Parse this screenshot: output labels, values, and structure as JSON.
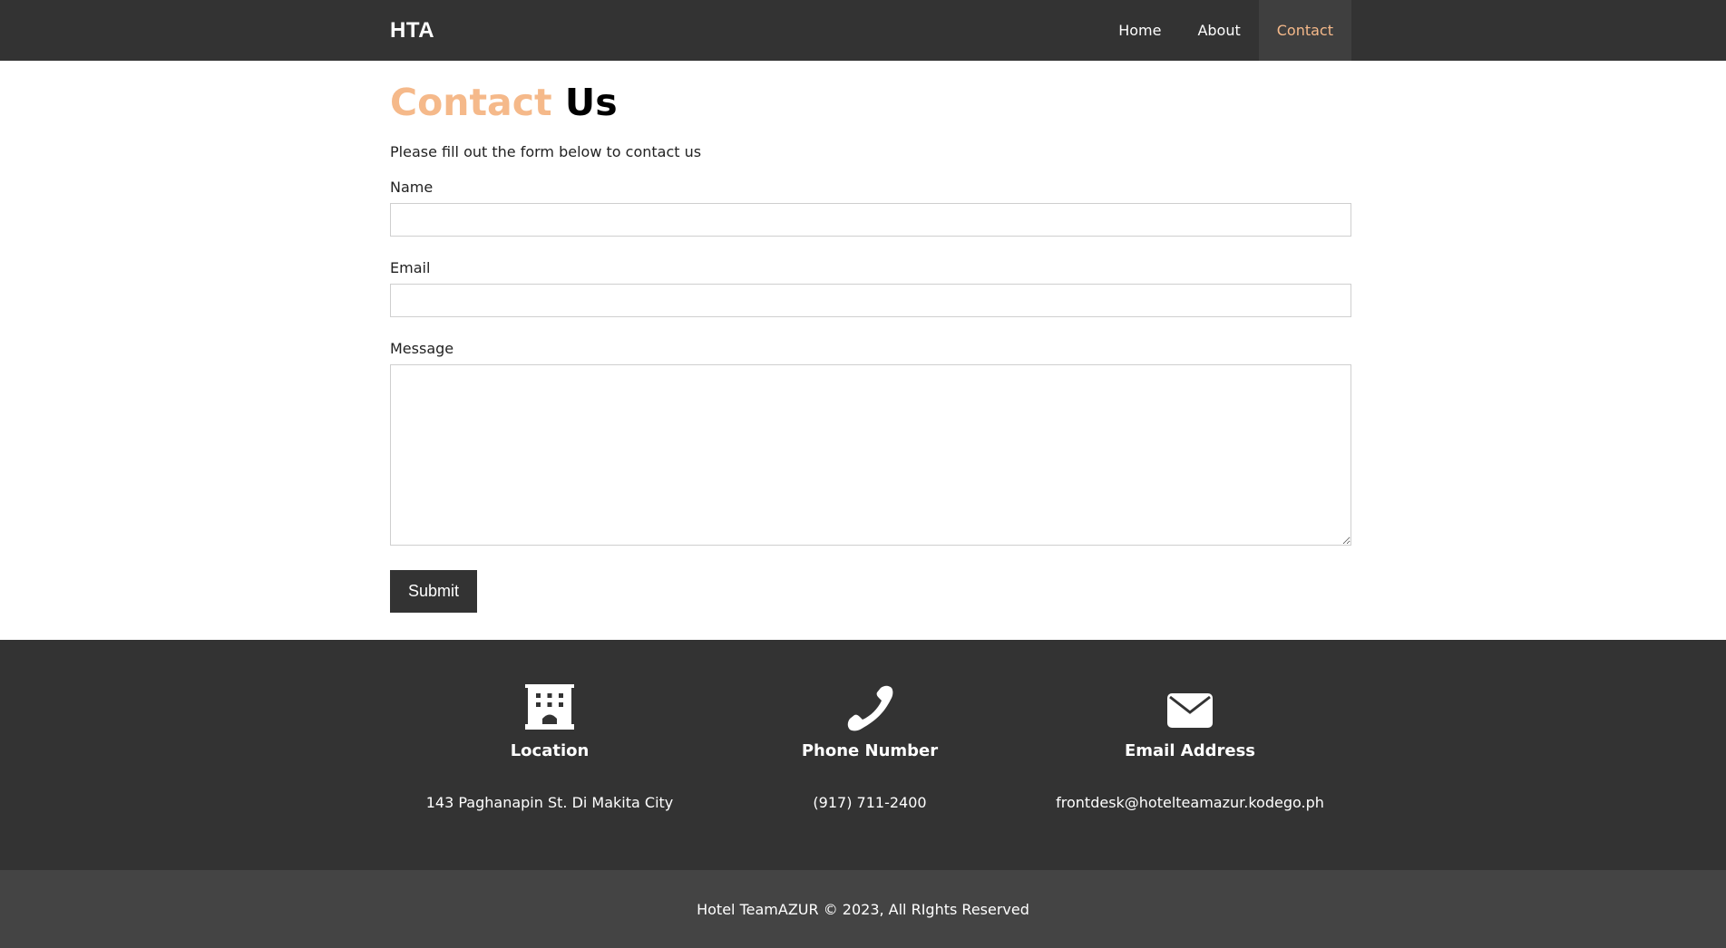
{
  "nav": {
    "brand": "HTA",
    "links": [
      {
        "label": "Home",
        "active": false
      },
      {
        "label": "About",
        "active": false
      },
      {
        "label": "Contact",
        "active": true
      }
    ]
  },
  "contact": {
    "heading_accent": "Contact",
    "heading_rest": "Us",
    "intro": "Please fill out the form below to contact us",
    "name_label": "Name",
    "name_value": "",
    "email_label": "Email",
    "email_value": "",
    "message_label": "Message",
    "message_value": "",
    "submit_label": "Submit"
  },
  "footer": {
    "location": {
      "icon": "building-icon",
      "title": "Location",
      "value": "143 Paghanapin St. Di Makita City"
    },
    "phone": {
      "icon": "phone-icon",
      "title": "Phone Number",
      "value": "(917) 711-2400"
    },
    "email": {
      "icon": "envelope-icon",
      "title": "Email Address",
      "value": "frontdesk@hotelteamazur.kodego.ph"
    },
    "copyright": "Hotel TeamAZUR © 2023, All RIghts Reserved"
  },
  "colors": {
    "nav_bg": "#333333",
    "accent": "#f5b98a",
    "footer_bg": "#333333",
    "footer_bottom_bg": "#444444"
  }
}
